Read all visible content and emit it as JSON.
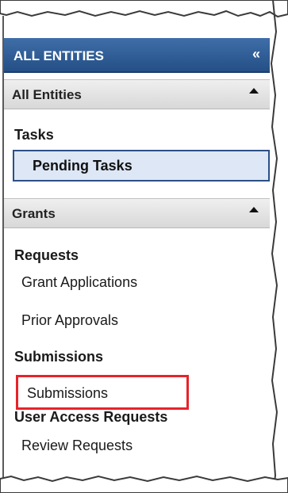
{
  "header": {
    "title": "ALL ENTITIES",
    "collapse_glyph": "«"
  },
  "sections": {
    "all_entities": {
      "label": "All Entities"
    },
    "grants": {
      "label": "Grants"
    }
  },
  "tasks": {
    "label": "Tasks",
    "pending": "Pending Tasks"
  },
  "requests": {
    "label": "Requests",
    "grant_applications": "Grant Applications",
    "prior_approvals": "Prior Approvals"
  },
  "submissions": {
    "label": "Submissions",
    "item": "Submissions"
  },
  "user_access": {
    "label": "User Access Requests",
    "review": "Review Requests"
  },
  "colors": {
    "header": "#244f86",
    "selection": "#dde7f5",
    "highlight": "#e8232a"
  }
}
